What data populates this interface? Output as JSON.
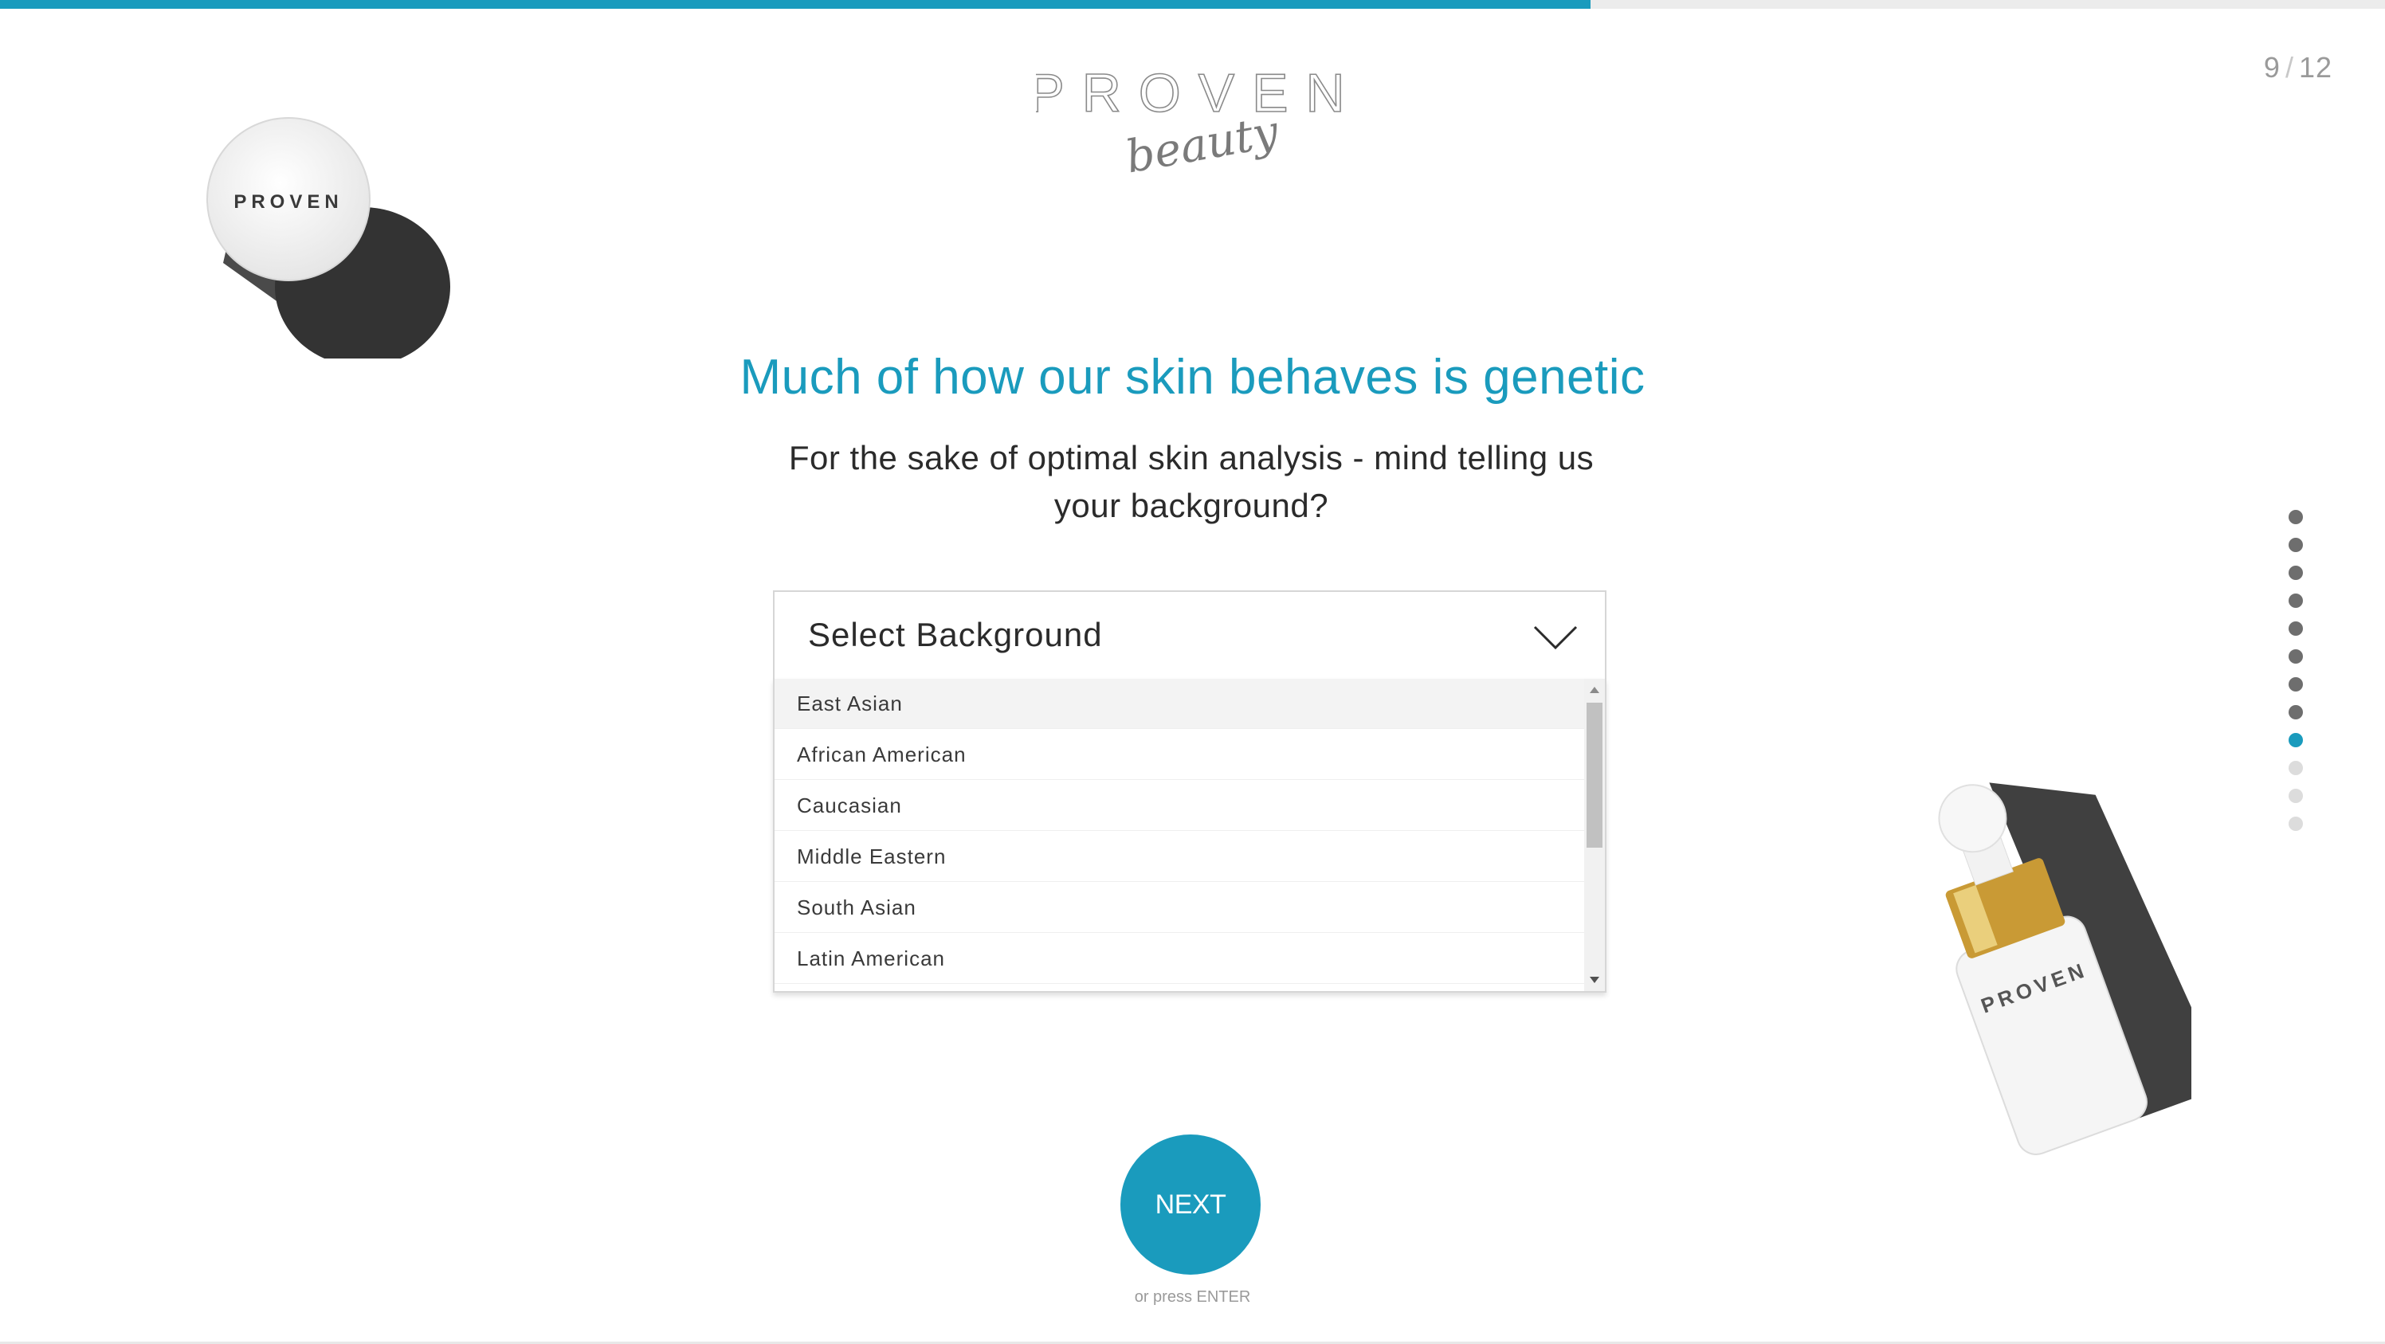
{
  "progress": {
    "fraction": 0.667
  },
  "step": {
    "current": "9",
    "separator": "/",
    "total": "12"
  },
  "logo": {
    "brand": "PROVEN",
    "script": "beauty"
  },
  "decor": {
    "jar_label": "PROVEN",
    "bottle_label": "PROVEN"
  },
  "question": {
    "headline": "Much of how our skin behaves is genetic",
    "subtext": "For the sake of optimal skin analysis - mind telling us your background?"
  },
  "select": {
    "placeholder": "Select Background",
    "options": [
      "East Asian",
      "African American",
      "Caucasian",
      "Middle Eastern",
      "South Asian",
      "Latin American"
    ],
    "hovered_option": "East Asian"
  },
  "pager": {
    "total": 12,
    "current": 9
  },
  "actions": {
    "next_label": "NEXT",
    "hint": "or press ENTER"
  },
  "colors": {
    "accent": "#1a9bbd",
    "dot_done": "#6e6e6e",
    "dot_todo": "#dcdcdc"
  }
}
